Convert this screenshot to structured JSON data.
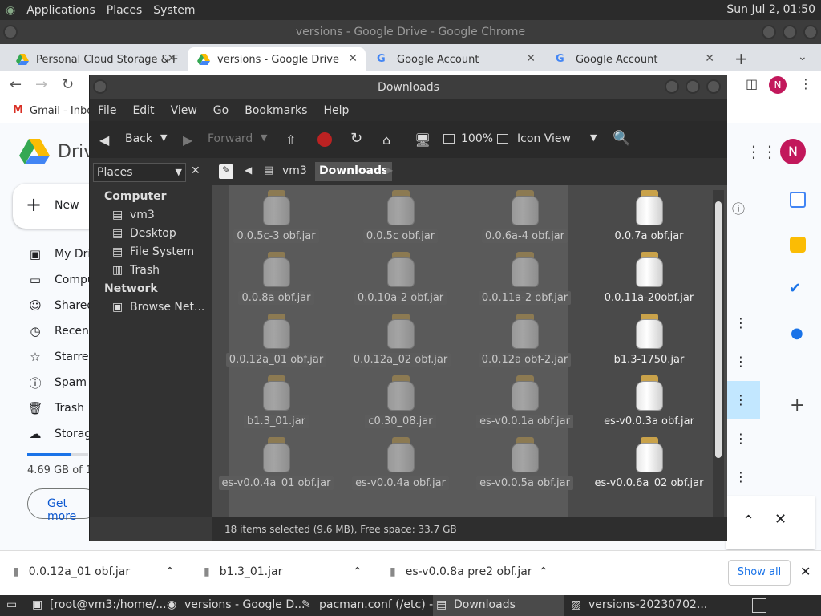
{
  "top_panel": {
    "applications": "Applications",
    "places": "Places",
    "system": "System",
    "clock": "Sun Jul  2, 01:50"
  },
  "chrome": {
    "window_title": "versions - Google Drive - Google Chrome",
    "tabs": [
      {
        "label": "Personal Cloud Storage & F",
        "active": false
      },
      {
        "label": "versions - Google Drive",
        "active": true
      },
      {
        "label": "Google Account",
        "active": false
      },
      {
        "label": "Google Account",
        "active": false
      }
    ],
    "profile_initial": "N",
    "bookmark_gmail": "Gmail - Inbo"
  },
  "drive": {
    "logo_text": "Drive",
    "new_label": "New",
    "sidebar": [
      {
        "label": "My Drive"
      },
      {
        "label": "Computers"
      },
      {
        "label": "Shared"
      },
      {
        "label": "Recent"
      },
      {
        "label": "Starred"
      },
      {
        "label": "Spam"
      },
      {
        "label": "Trash"
      },
      {
        "label": "Storage"
      }
    ],
    "storage_text": "4.69 GB of 1",
    "get_more": "Get more",
    "profile_initial": "N"
  },
  "nautilus": {
    "title": "Downloads",
    "menu": [
      "File",
      "Edit",
      "View",
      "Go",
      "Bookmarks",
      "Help"
    ],
    "toolbar": {
      "back": "Back",
      "forward": "Forward",
      "zoom": "100%",
      "view": "Icon View"
    },
    "side_header": "Places",
    "side": {
      "computer_header": "Computer",
      "computer_items": [
        "vm3",
        "Desktop",
        "File System",
        "Trash"
      ],
      "network_header": "Network",
      "network_items": [
        "Browse Net..."
      ]
    },
    "path": [
      "vm3",
      "Downloads"
    ],
    "files": [
      {
        "name": "0.0.5c-3 obf.jar",
        "sel": true
      },
      {
        "name": "0.0.5c obf.jar",
        "sel": true
      },
      {
        "name": "0.0.6a-4 obf.jar",
        "sel": true
      },
      {
        "name": "0.0.7a obf.jar",
        "sel": false
      },
      {
        "name": "0.0.8a obf.jar",
        "sel": true
      },
      {
        "name": "0.0.10a-2 obf.jar",
        "sel": true
      },
      {
        "name": "0.0.11a-2 obf.jar",
        "sel": true
      },
      {
        "name": "0.0.11a-20obf.jar",
        "sel": false
      },
      {
        "name": "0.0.12a_01 obf.jar",
        "sel": true
      },
      {
        "name": "0.0.12a_02 obf.jar",
        "sel": true
      },
      {
        "name": "0.0.12a obf-2.jar",
        "sel": true
      },
      {
        "name": "b1.3-1750.jar",
        "sel": false
      },
      {
        "name": "b1.3_01.jar",
        "sel": true
      },
      {
        "name": "c0.30_08.jar",
        "sel": true
      },
      {
        "name": "es-v0.0.1a obf.jar",
        "sel": true
      },
      {
        "name": "es-v0.0.3a obf.jar",
        "sel": false
      },
      {
        "name": "es-v0.0.4a_01 obf.jar",
        "sel": true
      },
      {
        "name": "es-v0.0.4a obf.jar",
        "sel": true
      },
      {
        "name": "es-v0.0.5a obf.jar",
        "sel": true
      },
      {
        "name": "es-v0.0.6a_02 obf.jar",
        "sel": false
      }
    ],
    "status": "18 items selected (9.6 MB), Free space: 33.7 GB"
  },
  "downloads_shelf": {
    "items": [
      "0.0.12a_01 obf.jar",
      "b1.3_01.jar",
      "es-v0.0.8a pre2 obf.jar"
    ],
    "show_all": "Show all"
  },
  "taskbar": {
    "items": [
      "[root@vm3:/home/...",
      "versions - Google D...",
      "pacman.conf (/etc) -...",
      "Downloads",
      "versions-20230702..."
    ]
  }
}
